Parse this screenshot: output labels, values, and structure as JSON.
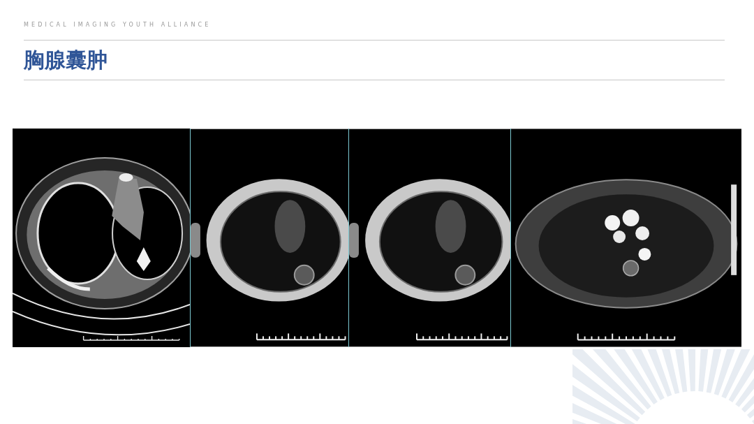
{
  "header": {
    "tagline": "MEDICAL IMAGING YOUTH ALLIANCE",
    "title": "胸腺囊肿"
  },
  "figure": {
    "images": [
      {
        "kind": "ct"
      },
      {
        "kind": "mri"
      },
      {
        "kind": "mri"
      },
      {
        "kind": "mri-contrast"
      }
    ]
  }
}
